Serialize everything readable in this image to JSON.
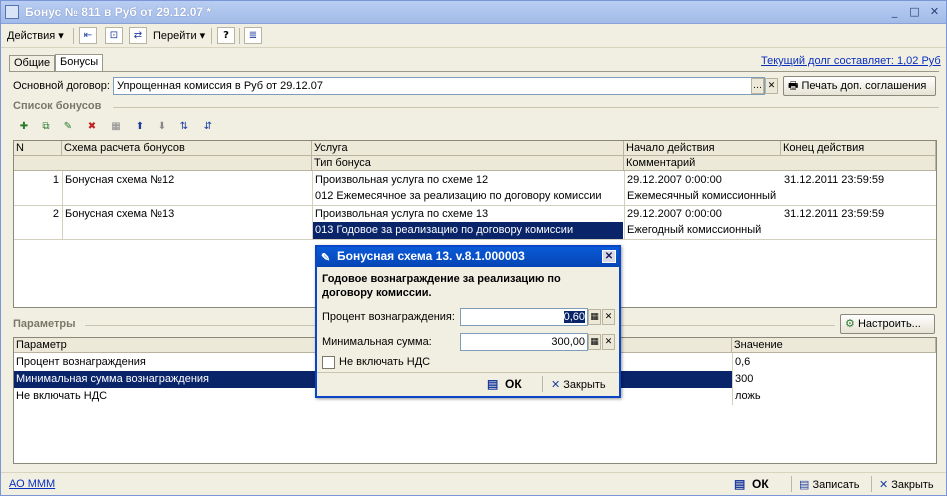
{
  "window": {
    "title": "Бонус № 811 в Руб от 29.12.07 *"
  },
  "menu": {
    "actions": "Действия",
    "goto": "Перейти",
    "help": "?"
  },
  "debt": "Текущий долг составляет: 1,02 Руб",
  "tabs": [
    "Общие",
    "Бонусы"
  ],
  "contract": {
    "label": "Основной договор:",
    "value": "Упрощенная комиссия в Руб от 29.12.07",
    "print_button": "Печать доп. соглашения"
  },
  "bonus_list": {
    "title": "Список бонусов",
    "headers": {
      "n": "N",
      "scheme": "Схема расчета бонусов",
      "service": "Услуга",
      "bonus_type": "Тип бонуса",
      "start": "Начало действия",
      "comment": "Комментарий",
      "end": "Конец действия"
    },
    "rows": [
      {
        "n": "1",
        "scheme": "Бонусная схема №12",
        "service": "Произвольная услуга по схеме 12",
        "bonus_type": "012 Ежемесячное за реализацию по договору комиссии",
        "start": "29.12.2007 0:00:00",
        "comment": "Ежемесячный комиссионный",
        "end": "31.12.2011 23:59:59"
      },
      {
        "n": "2",
        "scheme": "Бонусная схема №13",
        "service": "Произвольная услуга по схеме 13",
        "bonus_type": "013 Годовое за реализацию по договору комиссии",
        "start": "29.12.2007 0:00:00",
        "comment": "Ежегодный комиссионный",
        "end": "31.12.2011 23:59:59"
      }
    ]
  },
  "params": {
    "title": "Параметры",
    "configure": "Настроить...",
    "headers": {
      "param": "Параметр",
      "value": "Значение"
    },
    "rows": [
      {
        "param": "Процент вознаграждения",
        "value": "0,6"
      },
      {
        "param": "Минимальная сумма вознаграждения",
        "value": "300"
      },
      {
        "param": "Не включать НДС",
        "value": "ложь"
      }
    ]
  },
  "dialog": {
    "title": "Бонусная схема 13. v.8.1.000003",
    "heading": "Годовое вознаграждение за реализацию по договору комиссии.",
    "percent_label": "Процент вознаграждения:",
    "percent_value": "0,60",
    "min_label": "Минимальная сумма:",
    "min_value": "300,00",
    "vat_label": "Не включать НДС",
    "ok": "ОК",
    "close": "Закрыть"
  },
  "footer": {
    "org": "АО МММ",
    "ok": "ОК",
    "save": "Записать",
    "close": "Закрыть"
  }
}
